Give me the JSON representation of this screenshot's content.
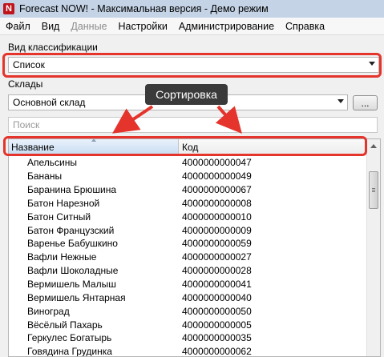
{
  "window": {
    "title": "Forecast NOW! - Максимальная версия - Демо режим"
  },
  "menu": [
    {
      "label": "Файл",
      "enabled": true
    },
    {
      "label": "Вид",
      "enabled": true
    },
    {
      "label": "Данные",
      "enabled": false
    },
    {
      "label": "Настройки",
      "enabled": true
    },
    {
      "label": "Администрирование",
      "enabled": true
    },
    {
      "label": "Справка",
      "enabled": true
    }
  ],
  "classification": {
    "label": "Вид классификации",
    "value": "Список"
  },
  "warehouses": {
    "label": "Склады",
    "value": "Основной склад",
    "browse_label": "..."
  },
  "search": {
    "placeholder": "Поиск",
    "value": ""
  },
  "annotation": {
    "text": "Сортировка",
    "color": "#e4342c"
  },
  "table": {
    "columns": [
      "Название",
      "Код"
    ],
    "rows": [
      {
        "name": "Апельсины",
        "code": "4000000000047"
      },
      {
        "name": "Бананы",
        "code": "4000000000049"
      },
      {
        "name": "Баранина Брюшина",
        "code": "4000000000067"
      },
      {
        "name": "Батон Нарезной",
        "code": "4000000000008"
      },
      {
        "name": "Батон Ситный",
        "code": "4000000000010"
      },
      {
        "name": "Батон Французский",
        "code": "4000000000009"
      },
      {
        "name": "Варенье Бабушкино",
        "code": "4000000000059"
      },
      {
        "name": "Вафли Нежные",
        "code": "4000000000027"
      },
      {
        "name": "Вафли Шоколадные",
        "code": "4000000000028"
      },
      {
        "name": "Вермишель Малыш",
        "code": "4000000000041"
      },
      {
        "name": "Вермишель Янтарная",
        "code": "4000000000040"
      },
      {
        "name": "Виноград",
        "code": "4000000000050"
      },
      {
        "name": "Вёсёлый Пахарь",
        "code": "4000000000005"
      },
      {
        "name": "Геркулес Богатырь",
        "code": "4000000000035"
      },
      {
        "name": "Говядина Грудинка",
        "code": "4000000000062"
      }
    ]
  }
}
